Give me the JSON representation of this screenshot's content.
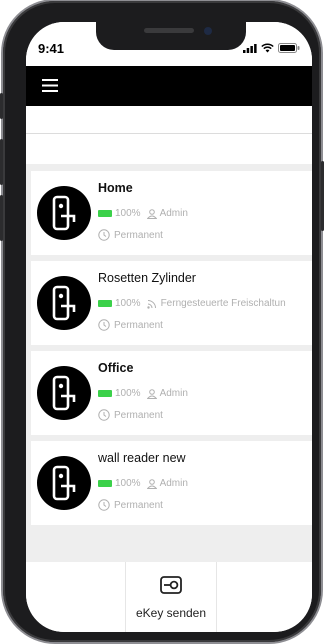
{
  "status_bar": {
    "time": "9:41"
  },
  "app_bar": {
    "menu_icon": "hamburger-menu-icon"
  },
  "locks": [
    {
      "name": "Home",
      "bold": true,
      "battery": "100%",
      "access_type": "Admin",
      "access_icon": "user-icon",
      "validity": "Permanent"
    },
    {
      "name": "Rosetten Zylinder",
      "bold": false,
      "battery": "100%",
      "access_type": "Ferngesteuerte Freischaltun",
      "access_icon": "remote-unlock-icon",
      "validity": "Permanent"
    },
    {
      "name": "Office",
      "bold": true,
      "battery": "100%",
      "access_type": "Admin",
      "access_icon": "user-icon",
      "validity": "Permanent"
    },
    {
      "name": "wall reader new",
      "bold": false,
      "battery": "100%",
      "access_type": "Admin",
      "access_icon": "user-icon",
      "validity": "Permanent"
    }
  ],
  "bottom_nav": {
    "send_label": "eKey senden",
    "send_icon": "ekey-send-icon"
  },
  "colors": {
    "battery": "#3bd14a",
    "app_bar": "#000000",
    "meta_text": "#b0b0b0"
  }
}
